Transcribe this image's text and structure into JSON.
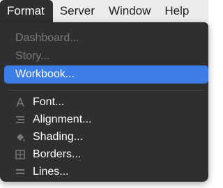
{
  "menubar": {
    "items": [
      {
        "label": "Format"
      },
      {
        "label": "Server"
      },
      {
        "label": "Window"
      },
      {
        "label": "Help"
      }
    ]
  },
  "format_menu": {
    "group1": [
      {
        "label": "Dashboard...",
        "enabled": false
      },
      {
        "label": "Story...",
        "enabled": false
      },
      {
        "label": "Workbook...",
        "enabled": true,
        "highlighted": true
      }
    ],
    "group2": [
      {
        "label": "Font...",
        "icon": "font-icon",
        "enabled": true
      },
      {
        "label": "Alignment...",
        "icon": "alignment-icon",
        "enabled": true
      },
      {
        "label": "Shading...",
        "icon": "paint-bucket-icon",
        "enabled": true
      },
      {
        "label": "Borders...",
        "icon": "borders-icon",
        "enabled": true
      },
      {
        "label": "Lines...",
        "icon": "lines-icon",
        "enabled": true
      }
    ]
  },
  "colors": {
    "menu_bg": "#2f2f31",
    "highlight": "#3d7ee6",
    "disabled_text": "#7a7a7c",
    "menubar_bg": "#ececec"
  }
}
